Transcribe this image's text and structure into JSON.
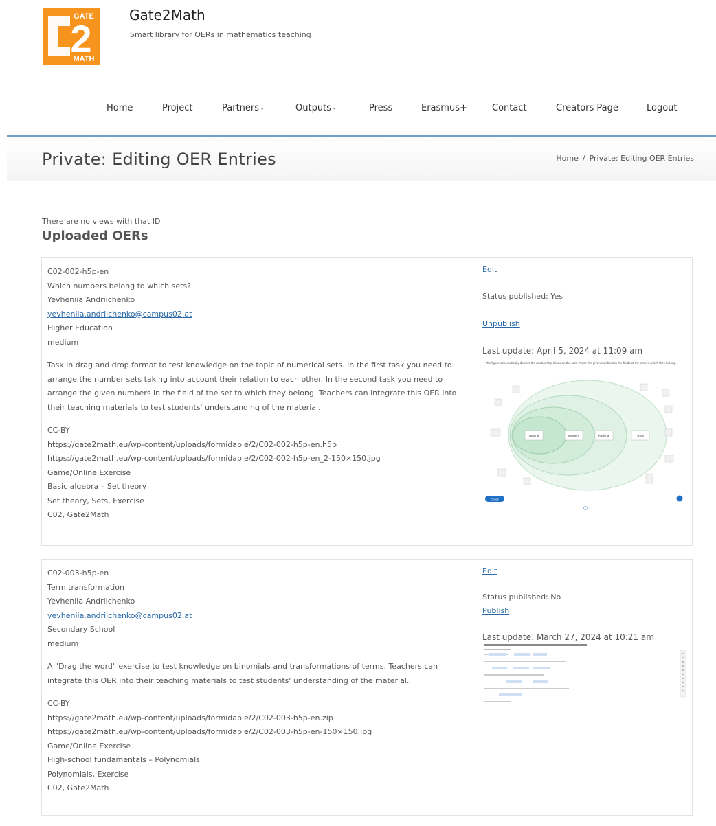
{
  "site": {
    "logo_text_top": "GATE",
    "logo_text_mid": "2",
    "logo_text_bottom": "MATH",
    "title": "Gate2Math",
    "tagline": "Smart library for OERs in mathematics teaching",
    "brand_color": "#f7941d",
    "accent_color": "#6f9fcf",
    "link_color": "#2a6aa8"
  },
  "nav": {
    "items": [
      {
        "label": "Home"
      },
      {
        "label": "Project"
      },
      {
        "label": "Partners",
        "caret": "-"
      },
      {
        "label": "Outputs",
        "caret": "-"
      },
      {
        "label": "Press"
      },
      {
        "label": "Erasmus+"
      },
      {
        "label": "Contact"
      },
      {
        "label": "Creators Page"
      },
      {
        "label": "Logout"
      }
    ]
  },
  "page": {
    "title": "Private: Editing OER Entries",
    "breadcrumb": {
      "home": "Home",
      "sep": "/",
      "current": "Private: Editing OER Entries"
    }
  },
  "content": {
    "no_views_notice": "There are no views with that ID",
    "section_title": "Uploaded OERs"
  },
  "entries": [
    {
      "id": "C02-002-h5p-en",
      "title": "Which numbers belong to which sets?",
      "author": "Yevheniia Andriichenko",
      "email": "yevheniia.andriichenko@campus02.at",
      "level": "Higher Education",
      "difficulty": "medium",
      "description": "Task in drag and drop format to test knowledge on the topic of numerical sets. In the first task you need to arrange the number sets taking into account their relation to each other. In the second task you need to arrange the given numbers in the field of the set to which they belong. Teachers can integrate this OER into their teaching materials to test students' understanding of the material.",
      "license": "CC-BY",
      "file_url": "https://gate2math.eu/wp-content/uploads/formidable/2/C02-002-h5p-en.h5p",
      "image_url": "https://gate2math.eu/wp-content/uploads/formidable/2/C02-002-h5p-en_2-150×150.jpg",
      "type": "Game/Online Exercise",
      "topic": "Basic algebra – Set theory",
      "keywords": "Set theory, Sets, Exercise",
      "tags": "C02, Gate2Math",
      "edit_label": "Edit",
      "status_text": "Status published: Yes",
      "action_label": "Unpublish",
      "last_update": "Last update: April 5, 2024 at 11:09 am",
      "thumb": {
        "caption": "The figure schematically depicts the relationship between the sets. Place the given numbers in the fields of the sets to which they belong.",
        "sets": [
          "Natural",
          "Integers",
          "Rational",
          "Real"
        ],
        "button": "Check"
      }
    },
    {
      "id": "C02-003-h5p-en",
      "title": "Term transformation",
      "author": "Yevheniia Andriichenko",
      "email": "yevheniia.andriichenko@campus02.at",
      "level": "Secondary School",
      "difficulty": "medium",
      "description": "A \"Drag the word\" exercise to test knowledge on binomials and transformations of terms. Teachers can integrate this OER into their teaching materials to test students' understanding of the material.",
      "license": "CC-BY",
      "file_url": "https://gate2math.eu/wp-content/uploads/formidable/2/C02-003-h5p-en.zip",
      "image_url": "https://gate2math.eu/wp-content/uploads/formidable/2/C02-003-h5p-en-150×150.jpg",
      "type": "Game/Online Exercise",
      "topic": "High-school fundamentals – Polynomials",
      "keywords": "Polynomials, Exercise",
      "tags": "C02, Gate2Math",
      "edit_label": "Edit",
      "status_text": "Status published: No",
      "action_label": "Publish",
      "last_update": "Last update: March 27, 2024 at 10:21 am"
    }
  ]
}
